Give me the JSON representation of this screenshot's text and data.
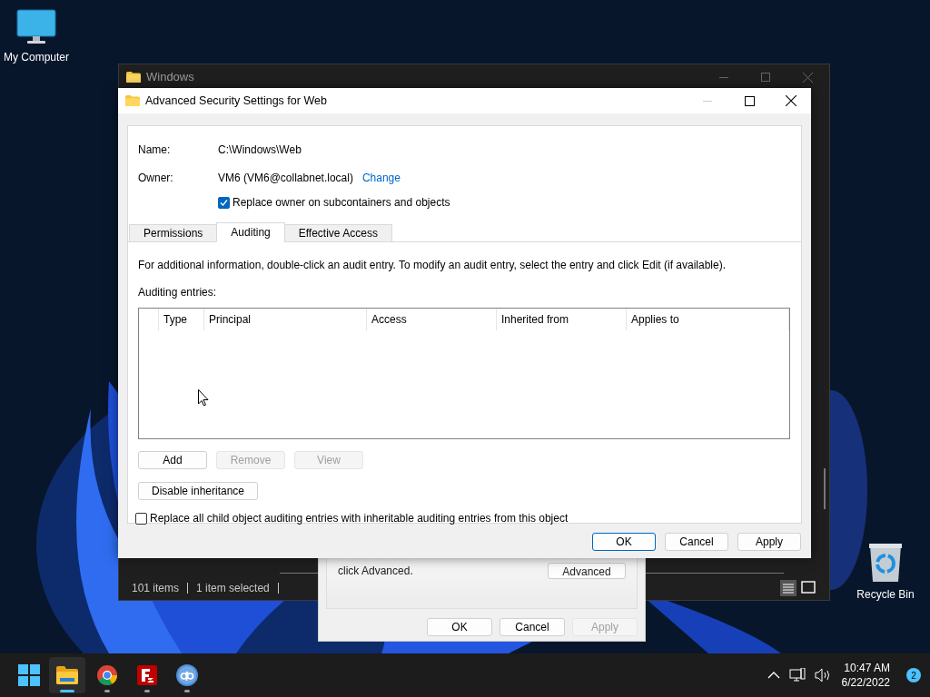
{
  "desktop_icons": [
    {
      "kind": "computer",
      "label": "My Computer"
    },
    {
      "kind": "recycle",
      "label": "Recycle Bin"
    }
  ],
  "explorer": {
    "title": "Windows",
    "status_bar": [
      "101 items",
      "1 item selected"
    ]
  },
  "back_dialog": {
    "text": "click Advanced.",
    "advanced_button": "Advanced",
    "buttons": [
      {
        "label": "OK",
        "disabled": false
      },
      {
        "label": "Cancel",
        "disabled": false
      },
      {
        "label": "Apply",
        "disabled": true
      }
    ]
  },
  "dialog": {
    "title": "Advanced Security Settings for Web",
    "name_label": "Name:",
    "name_value": "C:\\Windows\\Web",
    "owner_label": "Owner:",
    "owner_value": "VM6 (VM6@collabnet.local)",
    "change_link": "Change",
    "replace_owner": {
      "label": "Replace owner on subcontainers and objects",
      "checked": true
    },
    "tabs": [
      {
        "label": "Permissions",
        "selected": false
      },
      {
        "label": "Auditing",
        "selected": true
      },
      {
        "label": "Effective Access",
        "selected": false
      }
    ],
    "info": "For additional information, double-click an audit entry. To modify an audit entry, select the entry and click Edit (if available).",
    "entries_label": "Auditing entries:",
    "columns": [
      "Type",
      "Principal",
      "Access",
      "Inherited from",
      "Applies to"
    ],
    "entry_buttons": [
      {
        "label": "Add",
        "disabled": false
      },
      {
        "label": "Remove",
        "disabled": true
      },
      {
        "label": "View",
        "disabled": true
      }
    ],
    "disable_inheritance": "Disable inheritance",
    "replace_child": {
      "label": "Replace all child object auditing entries with inheritable auditing entries from this object",
      "checked": false
    },
    "footer_buttons": [
      {
        "label": "OK",
        "default": true
      },
      {
        "label": "Cancel",
        "default": false
      },
      {
        "label": "Apply",
        "default": false
      }
    ]
  },
  "taskbar": {
    "apps": [
      {
        "kind": "explorer",
        "active": true
      },
      {
        "kind": "chrome",
        "active": false
      },
      {
        "kind": "filezilla",
        "active": false
      },
      {
        "kind": "qbittorrent",
        "active": false
      }
    ],
    "time": "10:47 AM",
    "date": "6/22/2022",
    "notifications": "2"
  }
}
